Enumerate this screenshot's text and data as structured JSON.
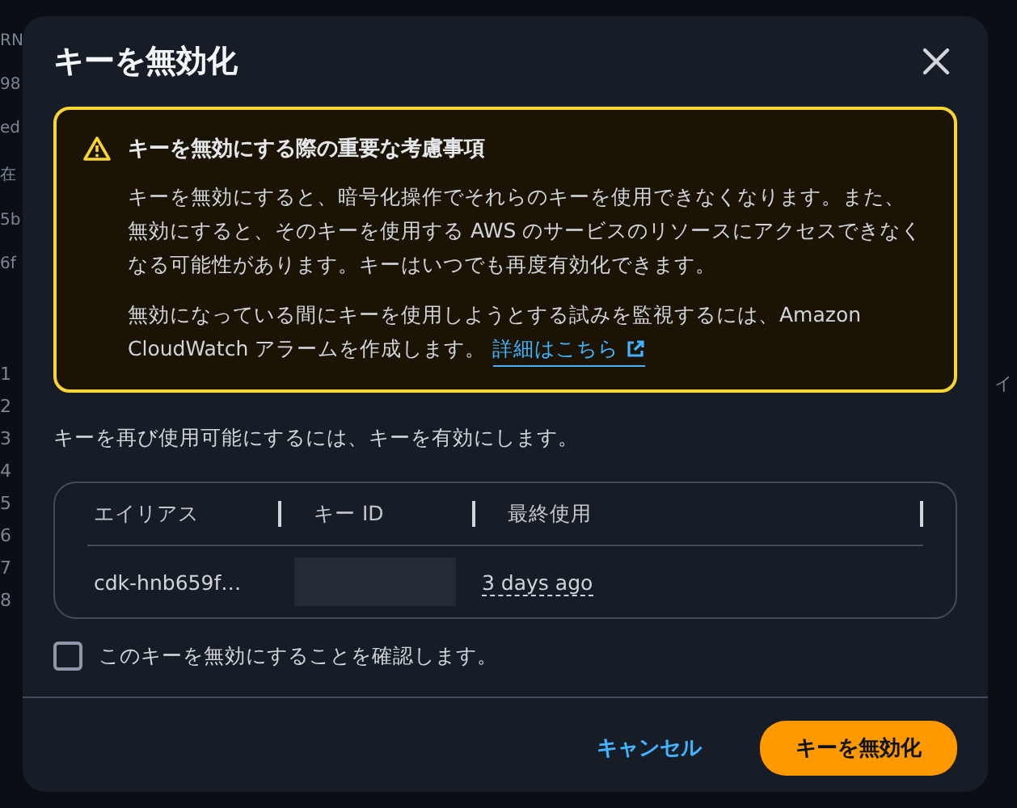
{
  "backdrop": {
    "left_texts": [
      "RN",
      "98",
      "ed",
      "在",
      "5b",
      "6f"
    ],
    "line_numbers": [
      "1",
      "2",
      "3",
      "4",
      "5",
      "6",
      "7",
      "8"
    ],
    "right_text": "イ"
  },
  "dialog": {
    "title": "キーを無効化",
    "alert": {
      "title": "キーを無効にする際の重要な考慮事項",
      "paragraph": "キーを無効にすると、暗号化操作でそれらのキーを使用できなくなります。また、無効にすると、そのキーを使用する AWS のサービスのリソースにアクセスできなくなる可能性があります。キーはいつでも再度有効化できます。",
      "paragraph_2": "無効になっている間にキーを使用しようとする試みを監視するには、Amazon CloudWatch アラームを作成します。",
      "link": "詳細はこちら"
    },
    "note": "キーを再び使用可能にするには、キーを有効にします。",
    "table": {
      "columns": [
        "エイリアス",
        "キー ID",
        "最終使用"
      ],
      "rows": [
        {
          "alias": "cdk-hnb659f…",
          "key_id_redacted": true,
          "last_used": "3 days ago"
        }
      ]
    },
    "confirm": {
      "label": "このキーを無効にすることを確認します。",
      "checked": false
    },
    "buttons": [
      {
        "label": "キャンセル",
        "kind": "link"
      },
      {
        "label": "キーを無効化",
        "kind": "primary"
      }
    ]
  }
}
